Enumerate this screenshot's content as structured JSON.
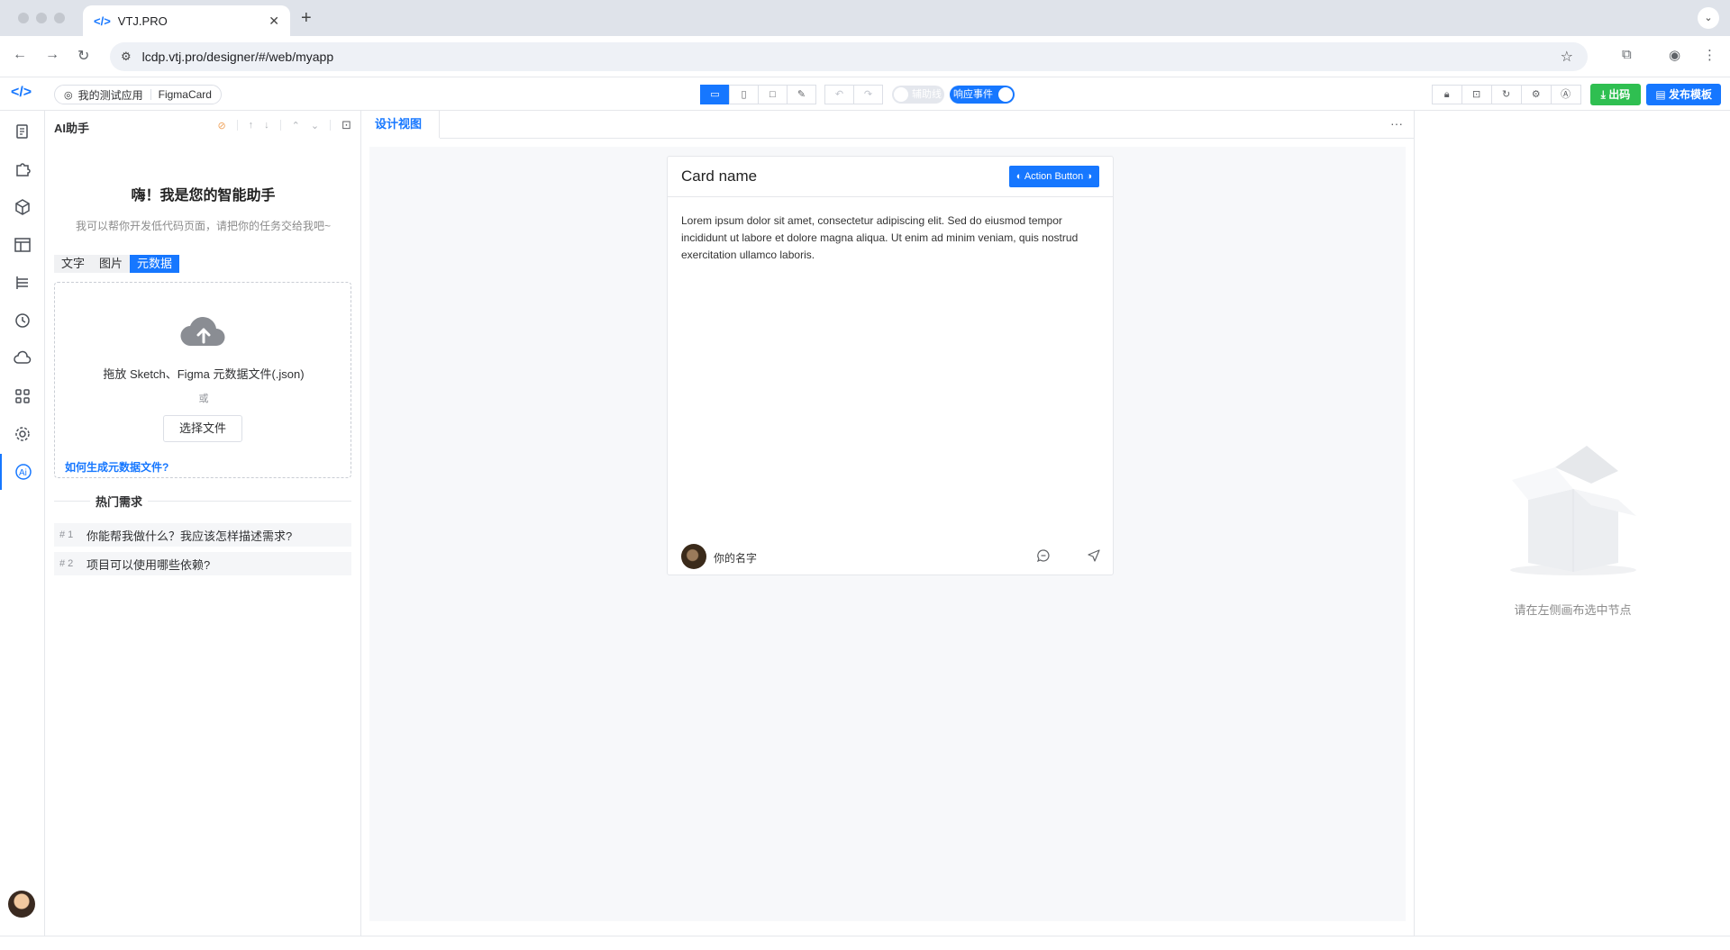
{
  "browser": {
    "tab_title": "VTJ.PRO",
    "tab_favicon": "</>",
    "url": "lcdp.vtj.pro/designer/#/web/myapp"
  },
  "toolbar": {
    "logo": "</>",
    "breadcrumb_app": "我的测试应用",
    "breadcrumb_page": "FigmaCard",
    "aux_line_label": "辅助线",
    "aux_line_on": false,
    "response_event_label": "响应事件",
    "response_event_on": true,
    "export_label": "出码",
    "publish_label": "发布模板"
  },
  "ai_panel": {
    "title": "AI助手",
    "greeting": "嗨！我是您的智能助手",
    "subtitle": "我可以帮你开发低代码页面，请把你的任务交给我吧~",
    "mode_tabs": [
      "文字",
      "图片",
      "元数据"
    ],
    "active_mode": "元数据",
    "drop_text": "拖放 Sketch、Figma 元数据文件(.json)",
    "or_text": "或",
    "choose_file_label": "选择文件",
    "help_link": "如何生成元数据文件?",
    "hot_title": "热门需求",
    "hot_items": [
      {
        "no": "# 1",
        "text": "你能帮我做什么？我应该怎样描述需求?"
      },
      {
        "no": "# 2",
        "text": "项目可以使用哪些依赖?"
      }
    ]
  },
  "design": {
    "tab_label": "设计视图",
    "more": "···",
    "card": {
      "title": "Card name",
      "action_label": "Action Button",
      "body": "Lorem ipsum dolor sit amet, consectetur adipiscing elit. Sed do eiusmod tempor incididunt ut labore et dolore magna aliqua. Ut enim ad minim veniam, quis nostrud exercitation ullamco laboris.",
      "author": "你的名字"
    }
  },
  "props_panel": {
    "empty_text": "请在左侧画布选中节点"
  },
  "colors": {
    "primary": "#1677ff",
    "success": "#2fbf51"
  }
}
